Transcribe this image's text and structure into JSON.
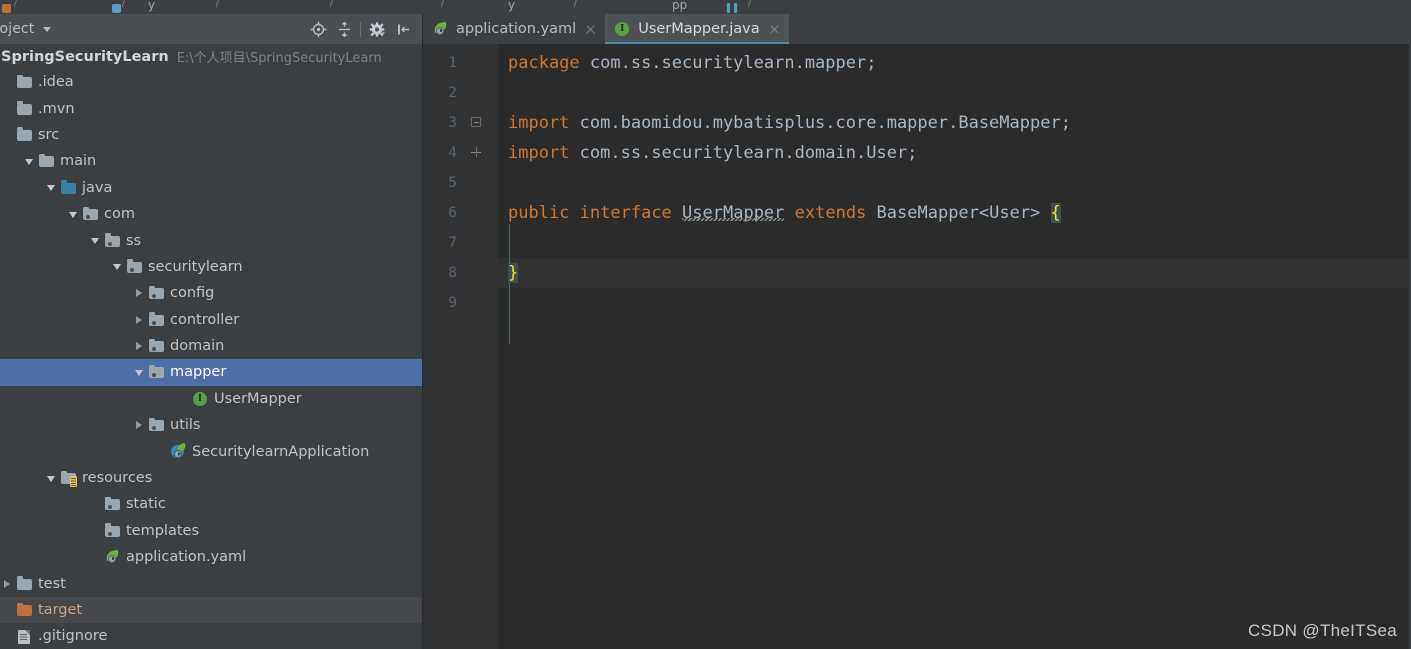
{
  "window": {
    "theme_bg": "#3c3f41",
    "editor_bg": "#2b2b2b",
    "selection_color": "#4d6fa8",
    "accent_color": "#4a88a8",
    "keyword_color": "#cc7832",
    "identifier_color": "#a9b7c6"
  },
  "navbar": {
    "breadcrumbs": [
      "y",
      "y",
      "pp"
    ]
  },
  "project_panel": {
    "title": "roject",
    "toolbar": [
      {
        "name": "select-opened-file-icon",
        "label": "Select Opened File"
      },
      {
        "name": "collapse-all-icon",
        "label": "Collapse All"
      },
      {
        "name": "gear-icon",
        "label": "Settings"
      },
      {
        "name": "hide-panel-icon",
        "label": "Hide"
      }
    ],
    "root": {
      "name": "SpringSecurityLearn",
      "path": "E:\\个人项目\\SpringSecurityLearn"
    },
    "tree": [
      {
        "label": ".idea",
        "indent": 0,
        "arrow": "none",
        "icon": "folder",
        "state": "normal"
      },
      {
        "label": ".mvn",
        "indent": 0,
        "arrow": "none",
        "icon": "folder",
        "state": "normal"
      },
      {
        "label": "src",
        "indent": 0,
        "arrow": "none",
        "icon": "folder",
        "state": "normal"
      },
      {
        "label": "main",
        "indent": 1,
        "arrow": "down",
        "icon": "folder",
        "state": "normal"
      },
      {
        "label": "java",
        "indent": 2,
        "arrow": "down",
        "icon": "source-root",
        "state": "normal"
      },
      {
        "label": "com",
        "indent": 3,
        "arrow": "down",
        "icon": "package",
        "state": "normal"
      },
      {
        "label": "ss",
        "indent": 4,
        "arrow": "down",
        "icon": "package",
        "state": "normal"
      },
      {
        "label": "securitylearn",
        "indent": 5,
        "arrow": "down",
        "icon": "package",
        "state": "normal"
      },
      {
        "label": "config",
        "indent": 6,
        "arrow": "right",
        "icon": "package",
        "state": "normal"
      },
      {
        "label": "controller",
        "indent": 6,
        "arrow": "right",
        "icon": "package",
        "state": "normal"
      },
      {
        "label": "domain",
        "indent": 6,
        "arrow": "right",
        "icon": "package",
        "state": "normal"
      },
      {
        "label": "mapper",
        "indent": 6,
        "arrow": "down",
        "icon": "package",
        "state": "selected"
      },
      {
        "label": "UserMapper",
        "indent": 8,
        "arrow": "none",
        "icon": "interface",
        "state": "normal"
      },
      {
        "label": "utils",
        "indent": 6,
        "arrow": "right",
        "icon": "package",
        "state": "normal"
      },
      {
        "label": "SecuritylearnApplication",
        "indent": 7,
        "arrow": "none",
        "icon": "spring-boot-app",
        "state": "normal"
      },
      {
        "label": "resources",
        "indent": 2,
        "arrow": "down",
        "icon": "resource-root",
        "state": "normal"
      },
      {
        "label": "static",
        "indent": 4,
        "arrow": "none",
        "icon": "package",
        "state": "normal"
      },
      {
        "label": "templates",
        "indent": 4,
        "arrow": "none",
        "icon": "package",
        "state": "normal"
      },
      {
        "label": "application.yaml",
        "indent": 4,
        "arrow": "none",
        "icon": "spring-leaf",
        "state": "normal"
      },
      {
        "label": "test",
        "indent": 0,
        "arrow": "right",
        "icon": "folder",
        "state": "normal"
      },
      {
        "label": "target",
        "indent": 0,
        "arrow": "none",
        "icon": "excluded",
        "state": "hover"
      },
      {
        "label": ".gitignore",
        "indent": 0,
        "arrow": "none",
        "icon": "file",
        "state": "normal"
      }
    ]
  },
  "editor": {
    "tabs": [
      {
        "label": "application.yaml",
        "icon": "spring-leaf",
        "active": false
      },
      {
        "label": "UserMapper.java",
        "icon": "interface",
        "active": true
      }
    ],
    "line_numbers": [
      "1",
      "2",
      "3",
      "4",
      "5",
      "6",
      "7",
      "8",
      "9"
    ],
    "caret_line": 8,
    "code_lines": [
      {
        "n": 1,
        "tokens": [
          {
            "t": "package",
            "c": "kw"
          },
          {
            "t": " com.ss.securitylearn.mapper;",
            "c": "id"
          }
        ]
      },
      {
        "n": 2,
        "tokens": []
      },
      {
        "n": 3,
        "tokens": [
          {
            "t": "import",
            "c": "kw"
          },
          {
            "t": " com.baomidou.mybatisplus.core.mapper.BaseMapper;",
            "c": "id"
          }
        ]
      },
      {
        "n": 4,
        "tokens": [
          {
            "t": "import",
            "c": "kw"
          },
          {
            "t": " com.ss.securitylearn.domain.User;",
            "c": "id"
          }
        ]
      },
      {
        "n": 5,
        "tokens": []
      },
      {
        "n": 6,
        "tokens": [
          {
            "t": "public",
            "c": "kw"
          },
          {
            "t": " ",
            "c": "id"
          },
          {
            "t": "interface",
            "c": "kw"
          },
          {
            "t": " ",
            "c": "id"
          },
          {
            "t": "UserMapper",
            "c": "warn"
          },
          {
            "t": " ",
            "c": "id"
          },
          {
            "t": "extends",
            "c": "kw"
          },
          {
            "t": " BaseMapper<User> ",
            "c": "id"
          },
          {
            "t": "{",
            "c": "brace"
          }
        ]
      },
      {
        "n": 7,
        "tokens": []
      },
      {
        "n": 8,
        "tokens": [
          {
            "t": "}",
            "c": "brace"
          }
        ]
      },
      {
        "n": 9,
        "tokens": []
      }
    ]
  },
  "watermark": "CSDN @TheITSea"
}
